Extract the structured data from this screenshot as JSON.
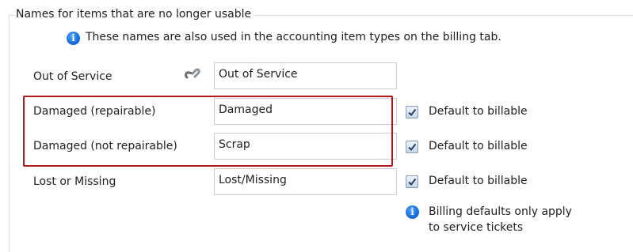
{
  "group": {
    "title": "Names for items that are no longer usable"
  },
  "info": {
    "text": "These names are also used in the accounting item types on the billing tab."
  },
  "rows": [
    {
      "label": "Out of Service",
      "value": "Out of Service"
    },
    {
      "label": "Damaged (repairable)",
      "value": "Damaged",
      "checkbox_label": "Default to billable",
      "checked": true
    },
    {
      "label": "Damaged (not repairable)",
      "value": "Scrap",
      "checkbox_label": "Default to billable",
      "checked": true
    },
    {
      "label": "Lost or Missing",
      "value": "Lost/Missing",
      "checkbox_label": "Default to billable",
      "checked": true
    }
  ],
  "note": {
    "line1": "Billing defaults only apply",
    "line2": "to service tickets"
  },
  "icons": {
    "info": "info-icon",
    "link": "link-icon",
    "check": "checkmark-icon"
  },
  "colors": {
    "highlight": "#b5161b",
    "info_icon": "#1a6fe0"
  }
}
